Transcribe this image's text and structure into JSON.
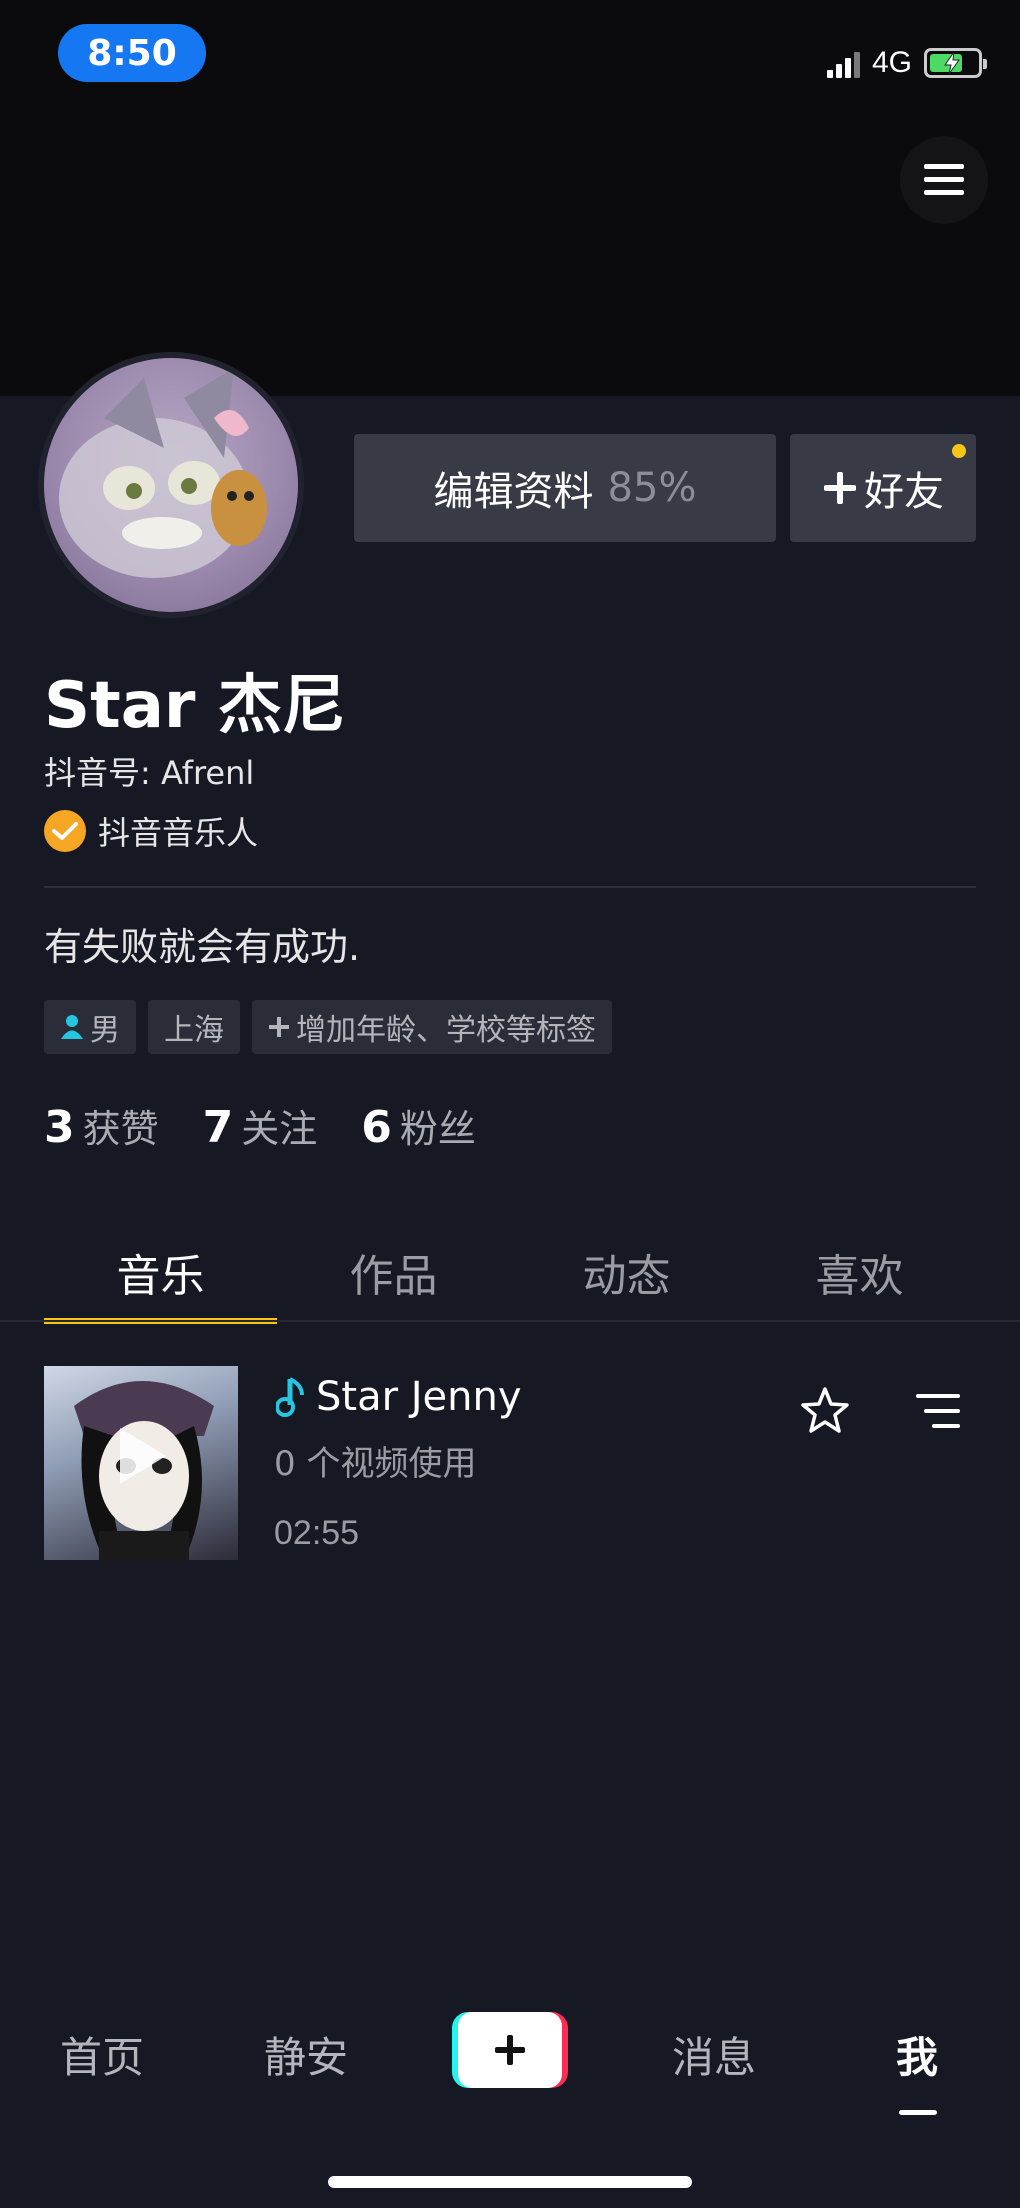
{
  "status_bar": {
    "time": "8:50",
    "network": "4G",
    "battery_level": 0.7,
    "time_pill_color": "#1677f2"
  },
  "header": {
    "menu_icon": "hamburger-menu-icon"
  },
  "profile": {
    "edit_label": "编辑资料",
    "edit_percent": "85%",
    "friend_label": "好友",
    "name": "Star 杰尼",
    "douyin_id": "抖音号: Afrenl",
    "badge_label": "抖音音乐人",
    "bio": "有失败就会有成功.",
    "tags": {
      "gender": "男",
      "city": "上海",
      "add_tag": "增加年龄、学校等标签"
    },
    "stats": [
      {
        "num": "3",
        "label": "获赞"
      },
      {
        "num": "7",
        "label": "关注"
      },
      {
        "num": "6",
        "label": "粉丝"
      }
    ]
  },
  "tabs": [
    {
      "label": "音乐",
      "active": true
    },
    {
      "label": "作品",
      "active": false
    },
    {
      "label": "动态",
      "active": false
    },
    {
      "label": "喜欢",
      "active": false
    }
  ],
  "track": {
    "title": "Star Jenny",
    "uses": "0 个视频使用",
    "duration": "02:55"
  },
  "bottom_nav": {
    "home": "首页",
    "location": "静安",
    "messages": "消息",
    "me": "我"
  },
  "colors": {
    "background": "#161824",
    "accent": "#f5c518",
    "badge": "#f5a623",
    "music_note": "#25c7e0"
  }
}
